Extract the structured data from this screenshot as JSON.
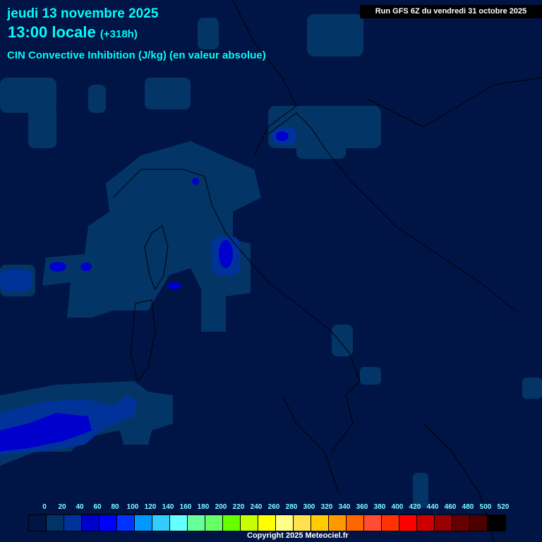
{
  "header": {
    "date": "jeudi 13 novembre 2025",
    "time": "13:00 locale",
    "offset": "(+318h)",
    "parameter": "CIN Convective Inhibition (J/kg) (en valeur absolue)"
  },
  "run": "Run GFS 6Z du vendredi 31 octobre 2025",
  "legend": {
    "labels": [
      "0",
      "20",
      "40",
      "60",
      "80",
      "100",
      "120",
      "140",
      "160",
      "180",
      "200",
      "220",
      "240",
      "260",
      "280",
      "300",
      "320",
      "340",
      "360",
      "380",
      "400",
      "420",
      "440",
      "460",
      "480",
      "500",
      "520"
    ],
    "colors": [
      "#001446",
      "#003366",
      "#003399",
      "#0000cc",
      "#0000ff",
      "#0033ff",
      "#0099ff",
      "#33ccff",
      "#66ffff",
      "#66ff99",
      "#66ff66",
      "#66ff00",
      "#c6ff00",
      "#ffff00",
      "#ffff88",
      "#ffe24d",
      "#ffcc00",
      "#ff9900",
      "#ff6600",
      "#ff4d33",
      "#ff3300",
      "#ff0000",
      "#cc0000",
      "#990000",
      "#660000",
      "#4d0000",
      "#000000"
    ]
  },
  "copyright": "Copyright 2025 Meteociel.fr"
}
